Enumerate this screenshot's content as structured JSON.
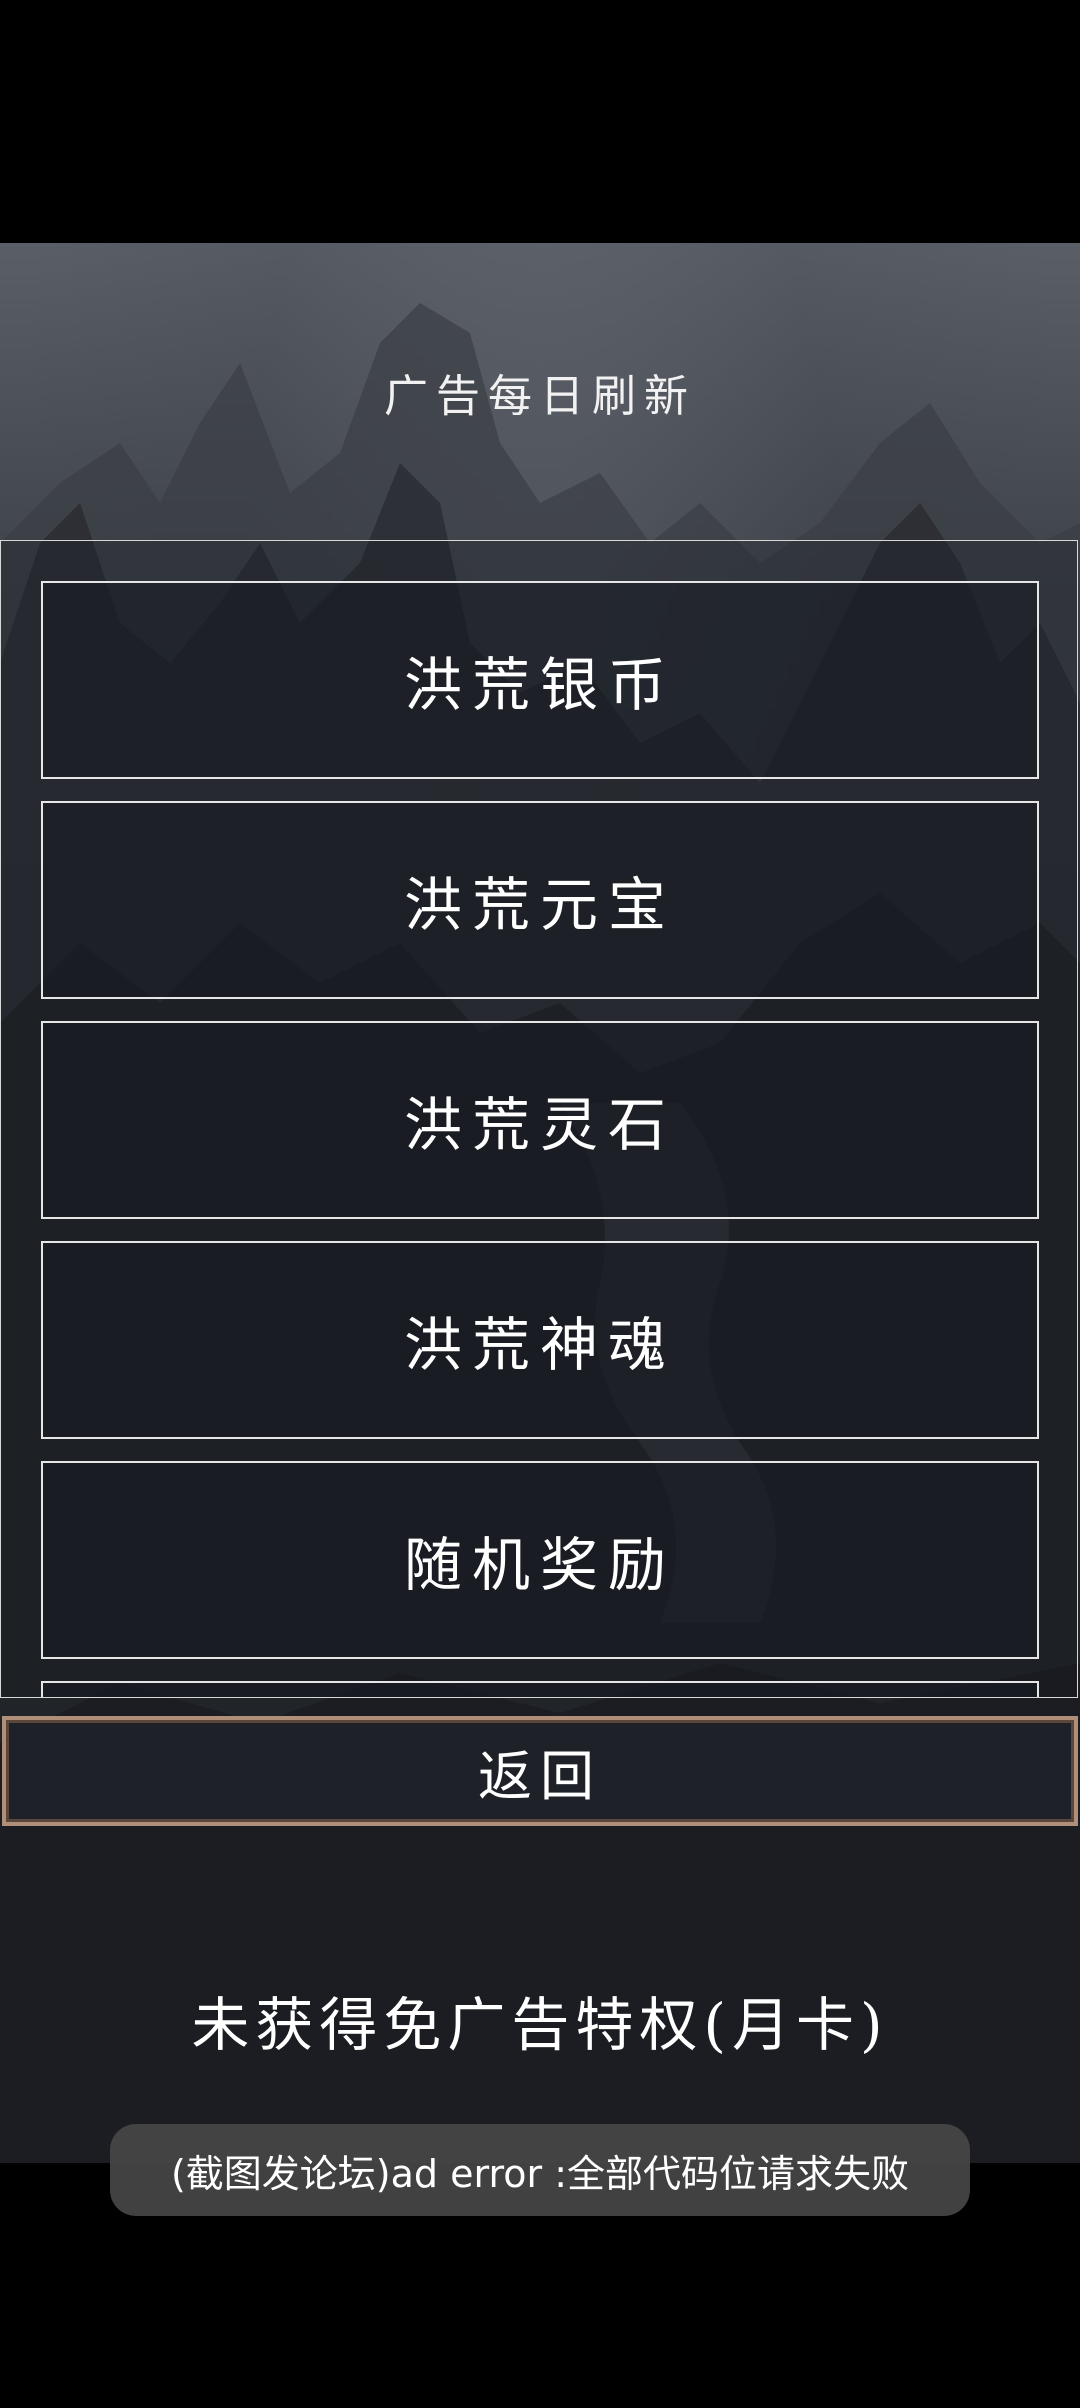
{
  "header": {
    "title": "广告每日刷新"
  },
  "reward_list": {
    "items": [
      {
        "label": "洪荒银币"
      },
      {
        "label": "洪荒元宝"
      },
      {
        "label": "洪荒灵石"
      },
      {
        "label": "洪荒神魂"
      },
      {
        "label": "随机奖励"
      }
    ]
  },
  "footer": {
    "return_label": "返回",
    "vip_status": "未获得免广告特权(月卡)"
  },
  "toast": {
    "message": "(截图发论坛)ad error :全部代码位请求失败"
  },
  "colors": {
    "background": "#000000",
    "scene": "#2b2f36",
    "item_border": "#e6e6e6",
    "return_border": "#b08f7a",
    "toast_bg": "#464646"
  }
}
